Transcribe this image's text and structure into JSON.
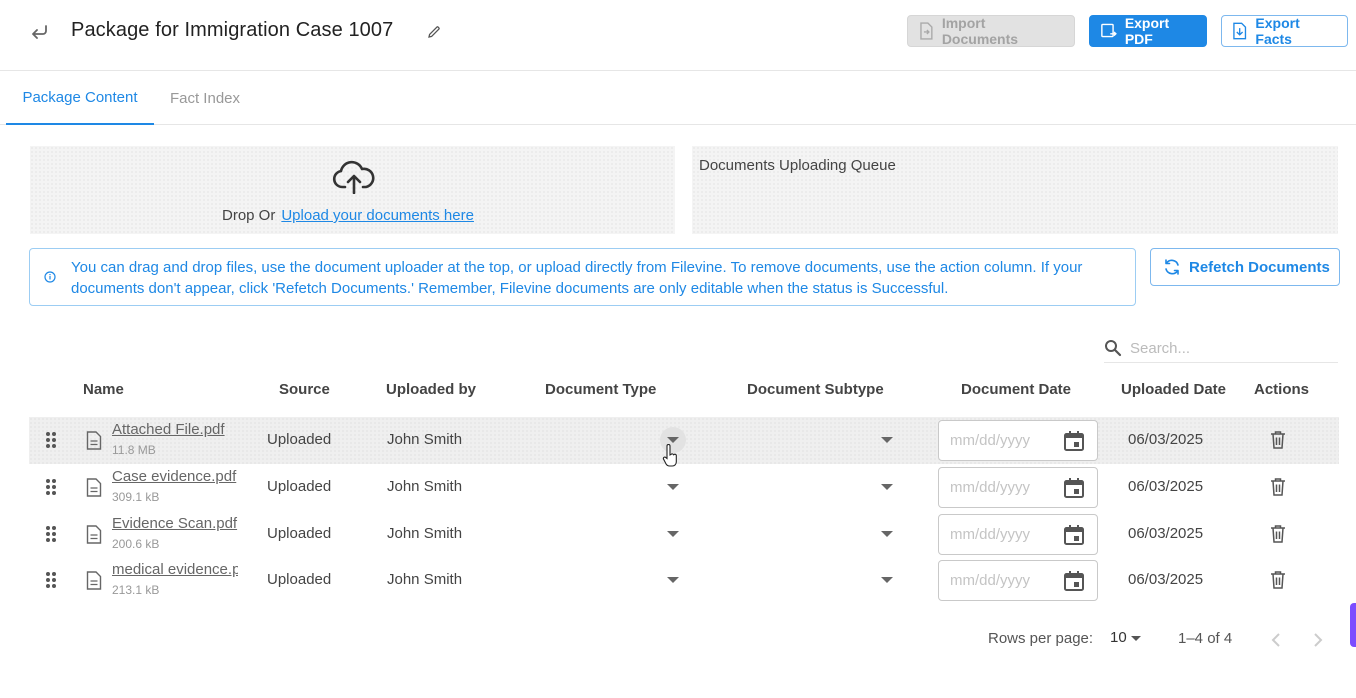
{
  "header": {
    "title": "Package for Immigration Case 1007",
    "back_icon": "back-arrow-icon",
    "edit_icon": "pencil-icon",
    "import_label": "Import Documents",
    "export_pdf_label": "Export PDF",
    "export_facts_label": "Export Facts"
  },
  "tabs": [
    {
      "label": "Package Content",
      "active": true
    },
    {
      "label": "Fact Index",
      "active": false
    }
  ],
  "dropzone": {
    "prefix": "Drop Or",
    "link": "Upload your documents here"
  },
  "queue": {
    "title": "Documents Uploading Queue"
  },
  "info": {
    "text": "You can drag and drop files, use the document uploader at the top, or upload directly from Filevine. To remove documents, use the action column. If your documents don't appear, click 'Refetch Documents.' Remember, Filevine documents are only editable when the status is Successful."
  },
  "refetch_label": "Refetch Documents",
  "search": {
    "placeholder": "Search..."
  },
  "table": {
    "columns": [
      "Name",
      "Source",
      "Uploaded by",
      "Document Type",
      "Document Subtype",
      "Document Date",
      "Uploaded Date",
      "Actions"
    ],
    "date_placeholder": "mm/dd/yyyy",
    "rows": [
      {
        "name": "Attached File.pdf",
        "size": "11.8 MB",
        "source": "Uploaded",
        "uploaded_by": "John Smith",
        "doc_type": "",
        "doc_subtype": "",
        "doc_date": "",
        "uploaded_date": "06/03/2025"
      },
      {
        "name": "Case evidence.pdf",
        "size": "309.1 kB",
        "source": "Uploaded",
        "uploaded_by": "John Smith",
        "doc_type": "",
        "doc_subtype": "",
        "doc_date": "",
        "uploaded_date": "06/03/2025"
      },
      {
        "name": "Evidence Scan.pdf",
        "size": "200.6 kB",
        "source": "Uploaded",
        "uploaded_by": "John Smith",
        "doc_type": "",
        "doc_subtype": "",
        "doc_date": "",
        "uploaded_date": "06/03/2025"
      },
      {
        "name": "medical evidence.pdf",
        "size": "213.1 kB",
        "source": "Uploaded",
        "uploaded_by": "John Smith",
        "doc_type": "",
        "doc_subtype": "",
        "doc_date": "",
        "uploaded_date": "06/03/2025"
      }
    ]
  },
  "pagination": {
    "rows_per_page_label": "Rows per page:",
    "rows_per_page": "10",
    "range": "1–4 of 4"
  },
  "colors": {
    "accent": "#1e88e5",
    "disabled": "#e2e2e2",
    "side_tab": "#7c4dff"
  }
}
